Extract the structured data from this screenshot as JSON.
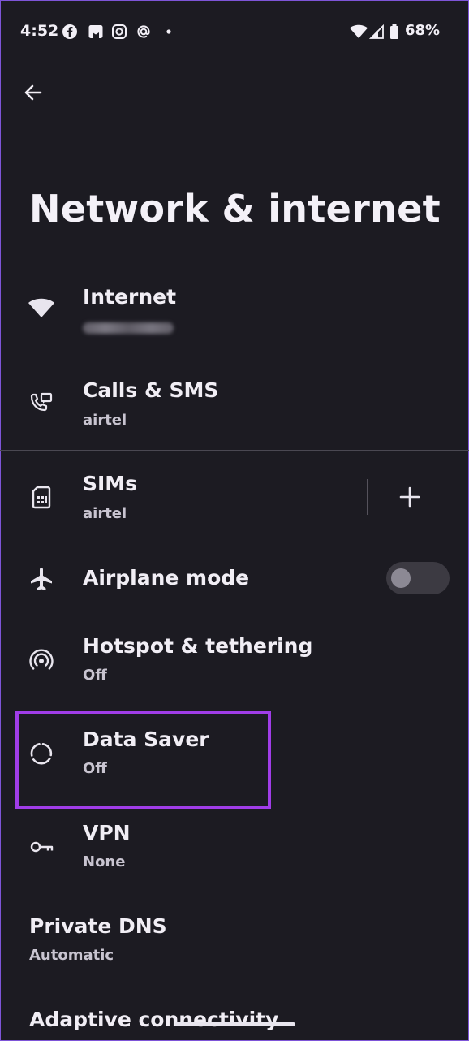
{
  "status_bar": {
    "time": "4:52",
    "battery_percent": "68%",
    "left_icons": [
      "facebook-icon",
      "bookmark-app-icon",
      "instagram-icon",
      "threads-icon",
      "dot-icon"
    ],
    "right_icons": [
      "wifi-icon",
      "cellular-signal-icon",
      "battery-icon"
    ]
  },
  "header": {
    "title": "Network & internet"
  },
  "settings": [
    {
      "id": "internet",
      "title": "Internet",
      "subtitle": "",
      "icon": "wifi-icon"
    },
    {
      "id": "calls-sms",
      "title": "Calls & SMS",
      "subtitle": "airtel",
      "icon": "calls-sms-icon"
    },
    {
      "id": "sims",
      "title": "SIMs",
      "subtitle": "airtel",
      "icon": "sim-card-icon"
    },
    {
      "id": "airplane-mode",
      "title": "Airplane mode",
      "subtitle": "",
      "icon": "airplane-icon",
      "toggle_on": false
    },
    {
      "id": "hotspot",
      "title": "Hotspot & tethering",
      "subtitle": "Off",
      "icon": "hotspot-icon"
    },
    {
      "id": "data-saver",
      "title": "Data Saver",
      "subtitle": "Off",
      "icon": "data-saver-icon"
    },
    {
      "id": "vpn",
      "title": "VPN",
      "subtitle": "None",
      "icon": "vpn-key-icon"
    },
    {
      "id": "private-dns",
      "title": "Private DNS",
      "subtitle": "Automatic"
    },
    {
      "id": "adaptive-connectivity",
      "title": "Adaptive connectivity"
    }
  ],
  "colors": {
    "background": "#1c1b22",
    "highlight": "#a03de8",
    "text_primary": "#f1eef5",
    "text_secondary": "#c8c4d0"
  }
}
